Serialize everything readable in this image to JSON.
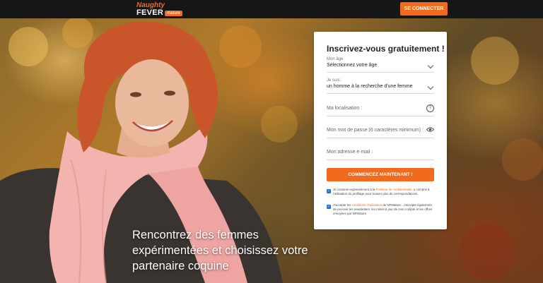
{
  "header": {
    "logo_line1": "Naughty",
    "logo_line2": "FEVER",
    "logo_badge": "mature",
    "connect_label": "SE CONNECTER"
  },
  "hero": {
    "headline": "Rencontrez des femmes expérimentées et choisissez votre partenaire coquine"
  },
  "form": {
    "title": "Inscrivez-vous gratuitement !",
    "age_label": "Mon âge",
    "age_value": "Sélectionnez votre âge",
    "seeking_label": "Je suis:",
    "seeking_value": "un homme à la recherche d'une femme",
    "location_placeholder": "Ma localisation :",
    "password_placeholder": "Mon mot de passe (6 caractères minimum) :",
    "email_placeholder": "Mon adresse e-mail :",
    "submit_label": "COMMENCEZ MAINTENANT !",
    "consent1_pre": "Je consens expressément à la ",
    "consent1_link": "Politique de confidentialité",
    "consent1_post": ", y compris à l'utilisation du profilage pour trouver plus de correspondances.",
    "consent2_pre": "J'accepte les ",
    "consent2_link": "conditions d'utilisation",
    "consent2_post": " de NFMature . J'accepte également de recevoir les newsletters, les mises à jour de mon compte et les offres envoyées par NFMature."
  },
  "colors": {
    "accent": "#f26b1d",
    "checkbox": "#1a73e8"
  }
}
